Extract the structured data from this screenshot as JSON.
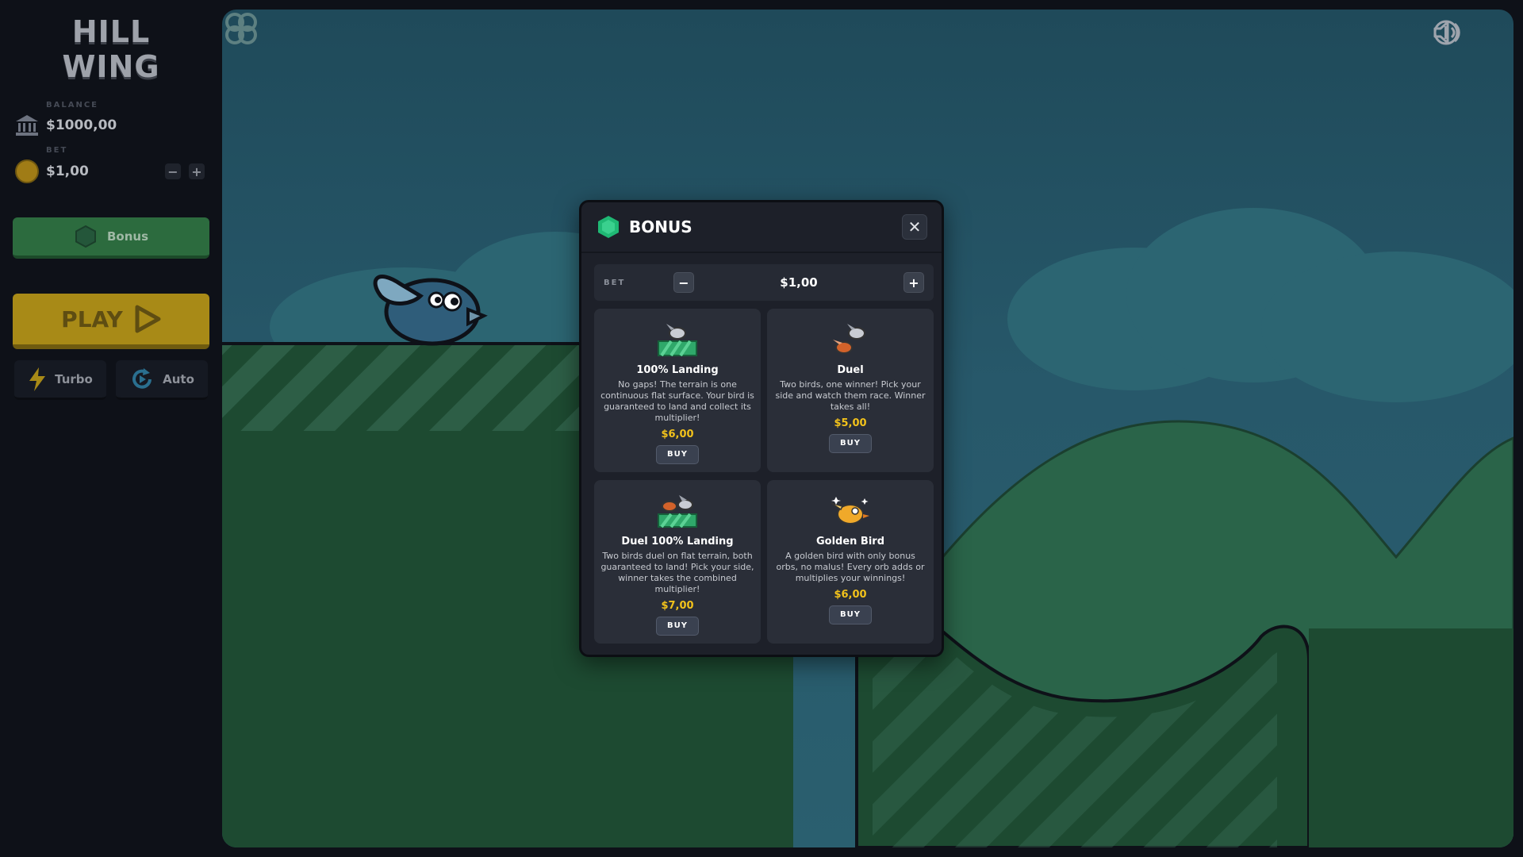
{
  "logo": {
    "line1": "HILL",
    "line2": "WING"
  },
  "balance": {
    "label": "BALANCE",
    "value": "$1000,00",
    "icon": "bank-icon"
  },
  "bet": {
    "label": "BET",
    "value": "$1,00",
    "icon": "coin-icon",
    "minus": "−",
    "plus": "+"
  },
  "sidebar": {
    "bonus_label": "Bonus",
    "play_label": "PLAY",
    "turbo_label": "Turbo",
    "auto_label": "Auto"
  },
  "colors": {
    "accent_green": "#2c6b3e",
    "play_gold": "#a88a17",
    "price_gold": "#f2c21b",
    "modal_bg": "#1d2029"
  },
  "modal": {
    "title": "BONUS",
    "close": "✕",
    "bet_label": "BET",
    "bet_value": "$1,00",
    "minus": "−",
    "plus": "+",
    "cards": [
      {
        "name": "100% Landing",
        "desc": "No gaps! The terrain is one continuous flat surface. Your bird is guaranteed to land and collect its multiplier!",
        "price": "$6,00",
        "buy": "BUY"
      },
      {
        "name": "Duel",
        "desc": "Two birds, one winner! Pick your side and watch them race. Winner takes all!",
        "price": "$5,00",
        "buy": "BUY"
      },
      {
        "name": "Duel 100% Landing",
        "desc": "Two birds duel on flat terrain, both guaranteed to land! Pick your side, winner takes the combined multiplier!",
        "price": "$7,00",
        "buy": "BUY"
      },
      {
        "name": "Golden Bird",
        "desc": "A golden bird with only bonus orbs, no malus! Every orb adds or multiplies your winnings!",
        "price": "$6,00",
        "buy": "BUY"
      }
    ]
  }
}
